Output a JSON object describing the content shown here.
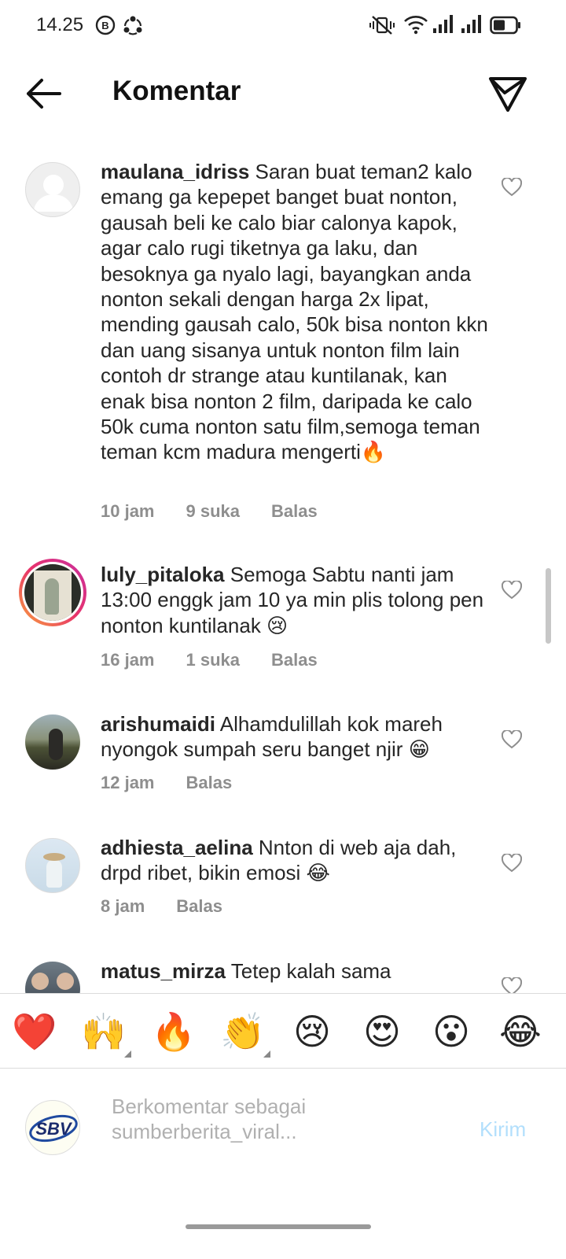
{
  "status_bar": {
    "time": "14.25"
  },
  "header": {
    "title": "Komentar"
  },
  "comments": [
    {
      "username": "maulana_idriss",
      "text": "Saran buat teman2 kalo emang ga kepepet banget buat nonton, gausah beli ke calo biar calonya kapok, agar calo rugi tiketnya ga laku, dan besoknya ga nyalo lagi, bayangkan anda nonton sekali dengan harga 2x lipat, mending gausah calo, 50k bisa nonton kkn dan uang sisanya untuk nonton film lain contoh dr strange atau kuntilanak, kan enak bisa nonton 2 film, daripada ke calo 50k cuma nonton satu film,semoga teman teman kcm madura mengerti🔥",
      "time": "10 jam",
      "likes": "9 suka",
      "reply": "Balas"
    },
    {
      "username": "luly_pitaloka",
      "text": "Semoga Sabtu nanti jam 13:00 enggk jam 10 ya min plis tolong pen nonton kuntilanak 😢",
      "time": "16 jam",
      "likes": "1 suka",
      "reply": "Balas"
    },
    {
      "username": "arishumaidi",
      "text": "Alhamdulillah kok mareh nyongok sumpah seru banget njir 😁",
      "time": "12 jam",
      "reply": "Balas"
    },
    {
      "username": "adhiesta_aelina",
      "text": "Nnton di web aja dah, drpd ribet, bikin emosi 😂",
      "time": "8 jam",
      "reply": "Balas"
    },
    {
      "username": "matus_mirza",
      "text": "Tetep kalah sama"
    }
  ],
  "emoji_bar": [
    "❤️",
    "🙌",
    "🔥",
    "👏",
    "😢",
    "😍",
    "😮",
    "😂"
  ],
  "input": {
    "placeholder": "Berkomentar sebagai sumberberita_viral...",
    "post_label": "Kirim",
    "avatar_text": "SBV"
  }
}
